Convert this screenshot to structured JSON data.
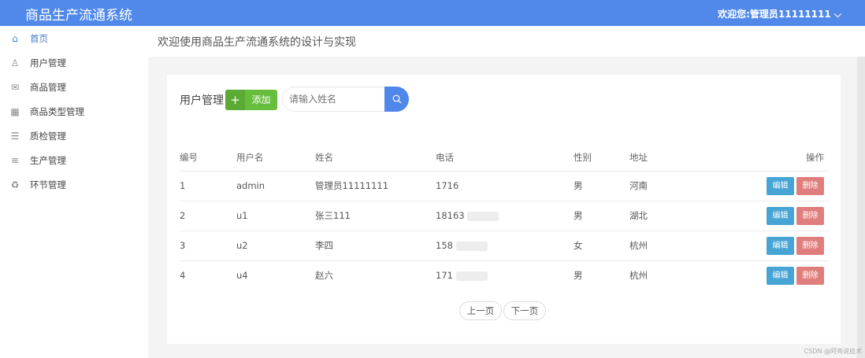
{
  "header": {
    "title": "商品生产流通系统",
    "user": "欢迎您:管理员11111111"
  },
  "sidebar": {
    "items": [
      {
        "label": "首页",
        "icon": "home-icon"
      },
      {
        "label": "用户管理",
        "icon": "user-icon"
      },
      {
        "label": "商品管理",
        "icon": "mail-icon"
      },
      {
        "label": "商品类型管理",
        "icon": "grid-icon"
      },
      {
        "label": "质检管理",
        "icon": "clipboard-icon"
      },
      {
        "label": "生产管理",
        "icon": "layers-icon"
      },
      {
        "label": "环节管理",
        "icon": "recycle-icon"
      }
    ]
  },
  "main": {
    "title": "欢迎使用商品生产流通系统的设计与实现"
  },
  "card": {
    "title": "用户管理",
    "add_label": "添加",
    "search_placeholder": "请输入姓名"
  },
  "table": {
    "headers": [
      "编号",
      "用户名",
      "姓名",
      "电话",
      "性别",
      "地址",
      "操作"
    ],
    "rows": [
      {
        "id": "1",
        "username": "admin",
        "name": "管理员11111111",
        "phone": "1716",
        "gender": "男",
        "address": "河南"
      },
      {
        "id": "2",
        "username": "u1",
        "name": "张三111",
        "phone": "18163",
        "gender": "男",
        "address": "湖北"
      },
      {
        "id": "3",
        "username": "u2",
        "name": "李四",
        "phone": "158",
        "gender": "女",
        "address": "杭州"
      },
      {
        "id": "4",
        "username": "u4",
        "name": "赵六",
        "phone": "171",
        "gender": "男",
        "address": "杭州"
      }
    ],
    "edit_label": "编辑",
    "delete_label": "删除"
  },
  "pager": {
    "prev": "上一页",
    "next": "下一页"
  },
  "watermark": "CSDN @阿亮说技术"
}
